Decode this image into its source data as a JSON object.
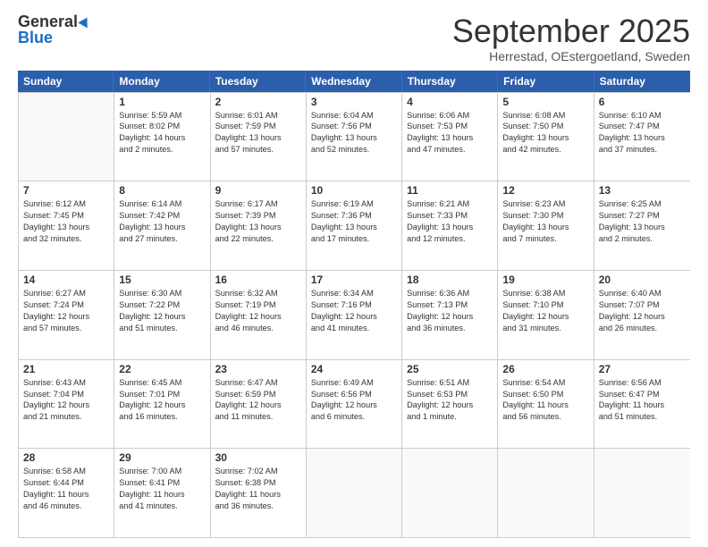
{
  "logo": {
    "general": "General",
    "blue": "Blue"
  },
  "title": "September 2025",
  "location": "Herrestad, OEstergoetland, Sweden",
  "header_days": [
    "Sunday",
    "Monday",
    "Tuesday",
    "Wednesday",
    "Thursday",
    "Friday",
    "Saturday"
  ],
  "weeks": [
    [
      {
        "day": "",
        "lines": []
      },
      {
        "day": "1",
        "lines": [
          "Sunrise: 5:59 AM",
          "Sunset: 8:02 PM",
          "Daylight: 14 hours",
          "and 2 minutes."
        ]
      },
      {
        "day": "2",
        "lines": [
          "Sunrise: 6:01 AM",
          "Sunset: 7:59 PM",
          "Daylight: 13 hours",
          "and 57 minutes."
        ]
      },
      {
        "day": "3",
        "lines": [
          "Sunrise: 6:04 AM",
          "Sunset: 7:56 PM",
          "Daylight: 13 hours",
          "and 52 minutes."
        ]
      },
      {
        "day": "4",
        "lines": [
          "Sunrise: 6:06 AM",
          "Sunset: 7:53 PM",
          "Daylight: 13 hours",
          "and 47 minutes."
        ]
      },
      {
        "day": "5",
        "lines": [
          "Sunrise: 6:08 AM",
          "Sunset: 7:50 PM",
          "Daylight: 13 hours",
          "and 42 minutes."
        ]
      },
      {
        "day": "6",
        "lines": [
          "Sunrise: 6:10 AM",
          "Sunset: 7:47 PM",
          "Daylight: 13 hours",
          "and 37 minutes."
        ]
      }
    ],
    [
      {
        "day": "7",
        "lines": [
          "Sunrise: 6:12 AM",
          "Sunset: 7:45 PM",
          "Daylight: 13 hours",
          "and 32 minutes."
        ]
      },
      {
        "day": "8",
        "lines": [
          "Sunrise: 6:14 AM",
          "Sunset: 7:42 PM",
          "Daylight: 13 hours",
          "and 27 minutes."
        ]
      },
      {
        "day": "9",
        "lines": [
          "Sunrise: 6:17 AM",
          "Sunset: 7:39 PM",
          "Daylight: 13 hours",
          "and 22 minutes."
        ]
      },
      {
        "day": "10",
        "lines": [
          "Sunrise: 6:19 AM",
          "Sunset: 7:36 PM",
          "Daylight: 13 hours",
          "and 17 minutes."
        ]
      },
      {
        "day": "11",
        "lines": [
          "Sunrise: 6:21 AM",
          "Sunset: 7:33 PM",
          "Daylight: 13 hours",
          "and 12 minutes."
        ]
      },
      {
        "day": "12",
        "lines": [
          "Sunrise: 6:23 AM",
          "Sunset: 7:30 PM",
          "Daylight: 13 hours",
          "and 7 minutes."
        ]
      },
      {
        "day": "13",
        "lines": [
          "Sunrise: 6:25 AM",
          "Sunset: 7:27 PM",
          "Daylight: 13 hours",
          "and 2 minutes."
        ]
      }
    ],
    [
      {
        "day": "14",
        "lines": [
          "Sunrise: 6:27 AM",
          "Sunset: 7:24 PM",
          "Daylight: 12 hours",
          "and 57 minutes."
        ]
      },
      {
        "day": "15",
        "lines": [
          "Sunrise: 6:30 AM",
          "Sunset: 7:22 PM",
          "Daylight: 12 hours",
          "and 51 minutes."
        ]
      },
      {
        "day": "16",
        "lines": [
          "Sunrise: 6:32 AM",
          "Sunset: 7:19 PM",
          "Daylight: 12 hours",
          "and 46 minutes."
        ]
      },
      {
        "day": "17",
        "lines": [
          "Sunrise: 6:34 AM",
          "Sunset: 7:16 PM",
          "Daylight: 12 hours",
          "and 41 minutes."
        ]
      },
      {
        "day": "18",
        "lines": [
          "Sunrise: 6:36 AM",
          "Sunset: 7:13 PM",
          "Daylight: 12 hours",
          "and 36 minutes."
        ]
      },
      {
        "day": "19",
        "lines": [
          "Sunrise: 6:38 AM",
          "Sunset: 7:10 PM",
          "Daylight: 12 hours",
          "and 31 minutes."
        ]
      },
      {
        "day": "20",
        "lines": [
          "Sunrise: 6:40 AM",
          "Sunset: 7:07 PM",
          "Daylight: 12 hours",
          "and 26 minutes."
        ]
      }
    ],
    [
      {
        "day": "21",
        "lines": [
          "Sunrise: 6:43 AM",
          "Sunset: 7:04 PM",
          "Daylight: 12 hours",
          "and 21 minutes."
        ]
      },
      {
        "day": "22",
        "lines": [
          "Sunrise: 6:45 AM",
          "Sunset: 7:01 PM",
          "Daylight: 12 hours",
          "and 16 minutes."
        ]
      },
      {
        "day": "23",
        "lines": [
          "Sunrise: 6:47 AM",
          "Sunset: 6:59 PM",
          "Daylight: 12 hours",
          "and 11 minutes."
        ]
      },
      {
        "day": "24",
        "lines": [
          "Sunrise: 6:49 AM",
          "Sunset: 6:56 PM",
          "Daylight: 12 hours",
          "and 6 minutes."
        ]
      },
      {
        "day": "25",
        "lines": [
          "Sunrise: 6:51 AM",
          "Sunset: 6:53 PM",
          "Daylight: 12 hours",
          "and 1 minute."
        ]
      },
      {
        "day": "26",
        "lines": [
          "Sunrise: 6:54 AM",
          "Sunset: 6:50 PM",
          "Daylight: 11 hours",
          "and 56 minutes."
        ]
      },
      {
        "day": "27",
        "lines": [
          "Sunrise: 6:56 AM",
          "Sunset: 6:47 PM",
          "Daylight: 11 hours",
          "and 51 minutes."
        ]
      }
    ],
    [
      {
        "day": "28",
        "lines": [
          "Sunrise: 6:58 AM",
          "Sunset: 6:44 PM",
          "Daylight: 11 hours",
          "and 46 minutes."
        ]
      },
      {
        "day": "29",
        "lines": [
          "Sunrise: 7:00 AM",
          "Sunset: 6:41 PM",
          "Daylight: 11 hours",
          "and 41 minutes."
        ]
      },
      {
        "day": "30",
        "lines": [
          "Sunrise: 7:02 AM",
          "Sunset: 6:38 PM",
          "Daylight: 11 hours",
          "and 36 minutes."
        ]
      },
      {
        "day": "",
        "lines": []
      },
      {
        "day": "",
        "lines": []
      },
      {
        "day": "",
        "lines": []
      },
      {
        "day": "",
        "lines": []
      }
    ]
  ]
}
